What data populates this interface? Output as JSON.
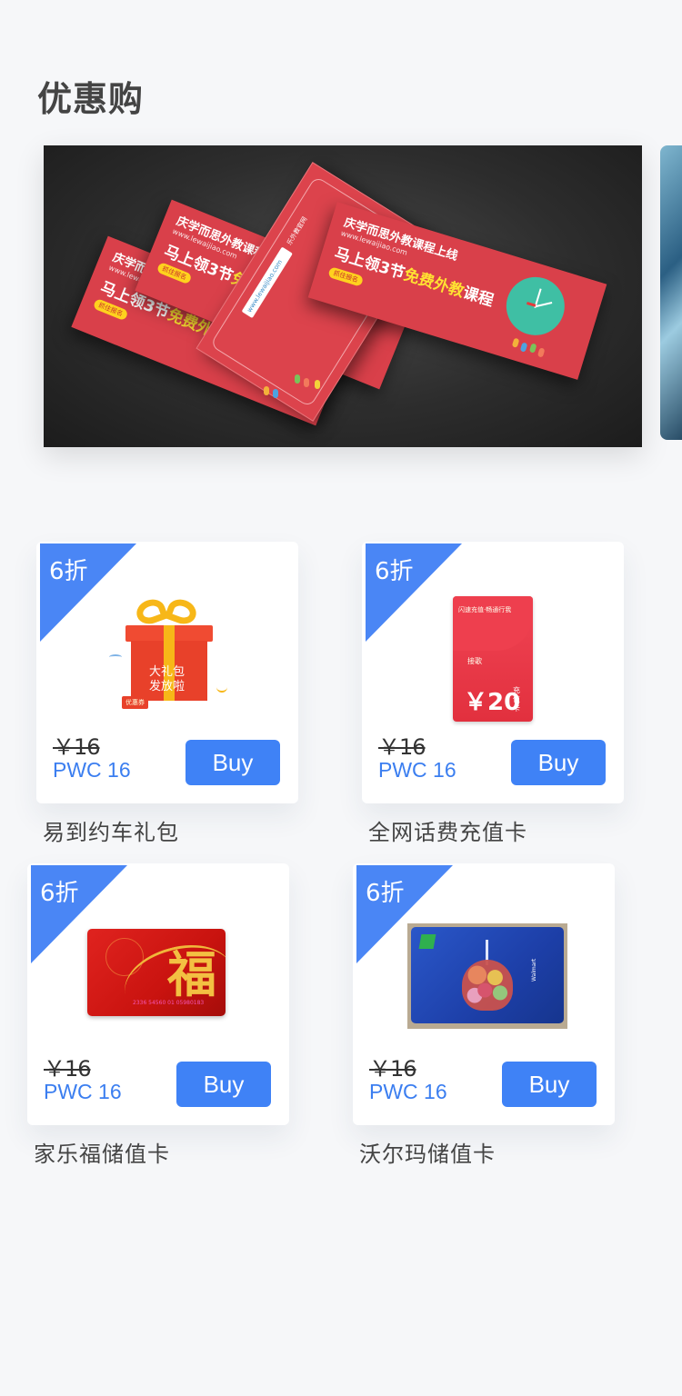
{
  "page": {
    "title": "优惠购"
  },
  "banner": {
    "flyer_headline": "庆学而思外教课程上线",
    "flyer_url": "www.lewaijiao.com",
    "flyer_big_prefix": "马上领3节",
    "flyer_big_highlight": "免费外教",
    "flyer_big_suffix": "课程",
    "flyer_button": "抓住报名",
    "envelope_url": "www.lewaijiao.com",
    "envelope_brand": "乐外教官网"
  },
  "products": [
    {
      "discount": "6折",
      "old_price": "￥16",
      "price": "PWC 16",
      "buy_label": "Buy",
      "name": "易到约车礼包",
      "image_icon": "gift-box-icon",
      "image_text_line1": "大礼包",
      "image_text_line2": "发放啦",
      "image_tag": "优惠券"
    },
    {
      "discount": "6折",
      "old_price": "￥16",
      "price": "PWC 16",
      "buy_label": "Buy",
      "name": "全网话费充值卡",
      "image_icon": "phone-recharge-card-icon",
      "image_text_top": "闪速充值·畅通行我",
      "image_text_mid": "接歌",
      "image_amount": "￥20",
      "image_suffix_1": "充",
      "image_suffix_2": "值",
      "image_suffix_3": "卡"
    },
    {
      "discount": "6折",
      "old_price": "￥16",
      "price": "PWC 16",
      "buy_label": "Buy",
      "name": "家乐福储值卡",
      "image_icon": "fu-gift-card-icon",
      "image_char": "福",
      "image_number": "2336 54560 01 05980183"
    },
    {
      "discount": "6折",
      "old_price": "￥16",
      "price": "PWC 16",
      "buy_label": "Buy",
      "name": "沃尔玛储值卡",
      "image_icon": "walmart-card-icon",
      "image_brand": "Walmart"
    }
  ]
}
